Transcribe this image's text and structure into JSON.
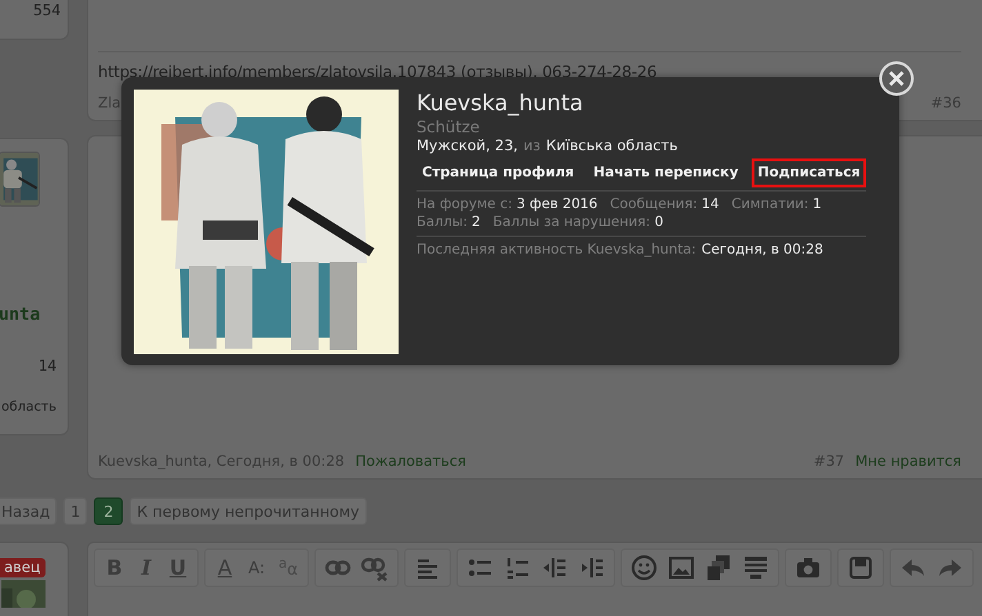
{
  "posts": [
    {
      "sidebar": {
        "count": "554"
      },
      "signature": "https://reibert.info/members/zlatovsila.107843 (отзывы), 063-274-28-26",
      "footer": {
        "author_date": "Zla",
        "number": "#36"
      }
    },
    {
      "sidebar": {
        "name": "unta",
        "count": "14",
        "location": "область"
      },
      "footer": {
        "author_date": "Kuevska_hunta, Сегодня, в 00:28",
        "report": "Пожаловаться",
        "number": "#37",
        "like": "Мне нравится"
      }
    }
  ],
  "pagination": [
    {
      "label": "Назад",
      "selected": false
    },
    {
      "label": "1",
      "selected": false
    },
    {
      "label": "2",
      "selected": true
    },
    {
      "label": "К первому непрочитанному",
      "selected": false
    }
  ],
  "editor": {
    "user_badge": "авец",
    "toolbar_text_groups": [
      [
        "B",
        "I",
        "U"
      ],
      [
        "A",
        "A:",
        "$^{a}$α"
      ]
    ]
  },
  "popup": {
    "name": "Kuevska_hunta",
    "title": "Schütze",
    "info": {
      "gender_age": "Мужской, 23,",
      "from": "из",
      "location": "Київська область"
    },
    "links": [
      {
        "label": "Страница профиля",
        "highlighted": false
      },
      {
        "label": "Начать переписку",
        "highlighted": false
      },
      {
        "label": "Подписаться",
        "highlighted": true
      }
    ],
    "stats": [
      {
        "label": "На форуме с:",
        "value": "3 фев 2016"
      },
      {
        "label": "Сообщения:",
        "value": "14"
      },
      {
        "label": "Симпатии:",
        "value": "1"
      },
      {
        "label": "Баллы:",
        "value": "2"
      },
      {
        "label": "Баллы за нарушения:",
        "value": "0"
      }
    ],
    "last_activity": {
      "label": "Последняя активность Kuevska_hunta:",
      "value": "Сегодня, в 00:28"
    }
  }
}
